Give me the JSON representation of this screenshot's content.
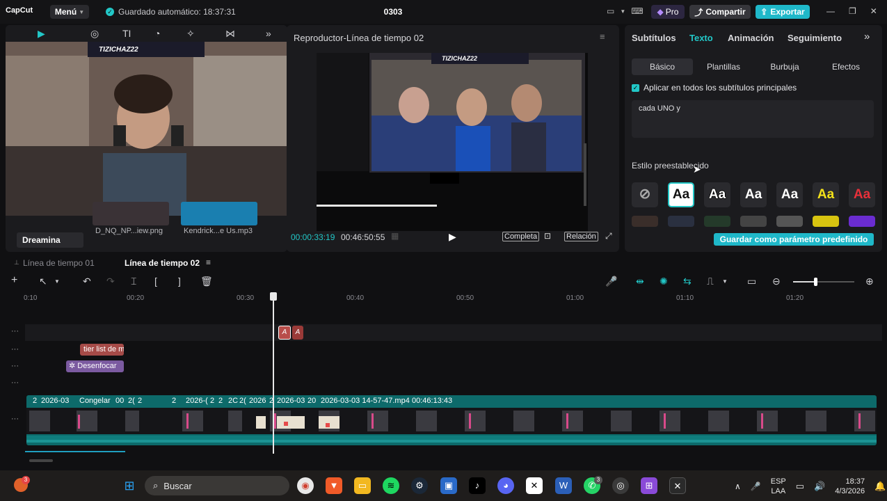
{
  "topbar": {
    "logo": "CapCut",
    "menu_label": "Menú",
    "autosave": "Guardado automático: 18:37:31",
    "project_title": "0303",
    "pro_label": "Pro",
    "share_label": "Compartir",
    "export_label": "Exportar"
  },
  "media_panel": {
    "overlay_title": "TIZICHAZ22",
    "side_item": "Dreamina",
    "files": [
      {
        "name": "D_NQ_NP...iew.png"
      },
      {
        "name": "Kendrick...e Us.mp3"
      }
    ]
  },
  "player": {
    "title": "Reproductor-Línea de tiempo 02",
    "overlay_title": "TIZICHAZ22",
    "current_time": "00:00:33:19",
    "total_time": "00:46:50:55",
    "full_label": "Completa",
    "ratio_label": "Relación"
  },
  "inspector": {
    "tabs": [
      "Subtítulos",
      "Texto",
      "Animación",
      "Seguimiento"
    ],
    "active_tab_index": 1,
    "subtabs": [
      "Básico",
      "Plantillas",
      "Burbuja",
      "Efectos"
    ],
    "apply_all_label": "Aplicar en todos los subtítulos principales",
    "text_value": "cada UNO y",
    "preset_title": "Estilo preestablecido",
    "preset_sample": "Aa",
    "save_preset_label": "Guardar como parámetro predefinido",
    "accent": "#22c7c7"
  },
  "timeline": {
    "tabs": [
      "Línea de tiempo 01",
      "Línea de tiempo 02"
    ],
    "ruler": [
      "0:10",
      "00:20",
      "00:30",
      "00:40",
      "00:50",
      "01:00",
      "01:10",
      "01:20"
    ],
    "clips": {
      "caption_clip": "tier list de m",
      "effect_clip": "Desenfocar"
    },
    "main_track_labels": [
      "2",
      "2026-03",
      "Congelar",
      "00",
      "2(",
      "2",
      "2",
      "2026-(",
      "2",
      "2",
      "2C",
      "2(",
      "2026",
      "2",
      "2026-03",
      "20",
      "2026-03-03 14-57-47.mp4",
      "00:46:13:43"
    ]
  },
  "taskbar": {
    "search_placeholder": "Buscar",
    "notification_count": "3",
    "whatsapp_badge": "3",
    "lang_top": "ESP",
    "lang_bottom": "LAA",
    "time": "18:37",
    "date": "4/3/2026"
  }
}
